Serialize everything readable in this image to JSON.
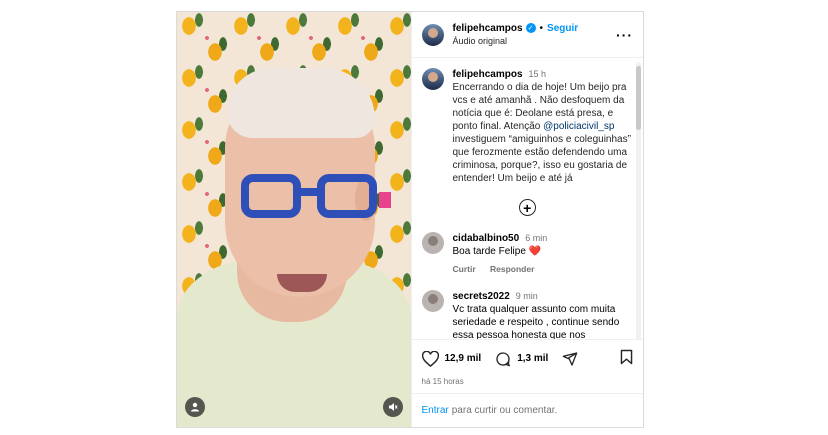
{
  "post": {
    "username": "felipehcampos",
    "follow_label": "Seguir",
    "audio_label": "Áudio original",
    "more_icon": "ellipsis-icon",
    "caption": {
      "username": "felipehcampos",
      "time": "15 h",
      "text_before": "Encerrando o dia de hoje! Um beijo pra vcs e até amanhã . Não desfoquem da notícia que é: Deolane está presa, e ponto final. Atenção ",
      "mention": "@policiacivil_sp",
      "text_after": " investiguem “amiguinhos e coleguinhas” que ferozmente estão defendendo uma criminosa, porque?, isso eu gostaria de entender! Um beijo e até já"
    },
    "comments": [
      {
        "username": "cidabalbino50",
        "time": "6 min",
        "text": "Boa tarde Felipe",
        "emoji": "❤️",
        "reply_label": "Curtir",
        "reply2_label": "Responder"
      },
      {
        "username": "secrets2022",
        "time": "9 min",
        "text": "Vc trata qualquer assunto com muita seriedade e respeito , continue sendo essa pessoa honesta que nos"
      }
    ],
    "likes": "12,9 mil",
    "comments_count": "1,3 mil",
    "posted_ago": "há 15 horas",
    "login_link": "Entrar",
    "login_text": "para curtir ou comentar.",
    "colors": {
      "accent": "#0095f6",
      "mention": "#00376b",
      "muted": "#737373"
    }
  }
}
